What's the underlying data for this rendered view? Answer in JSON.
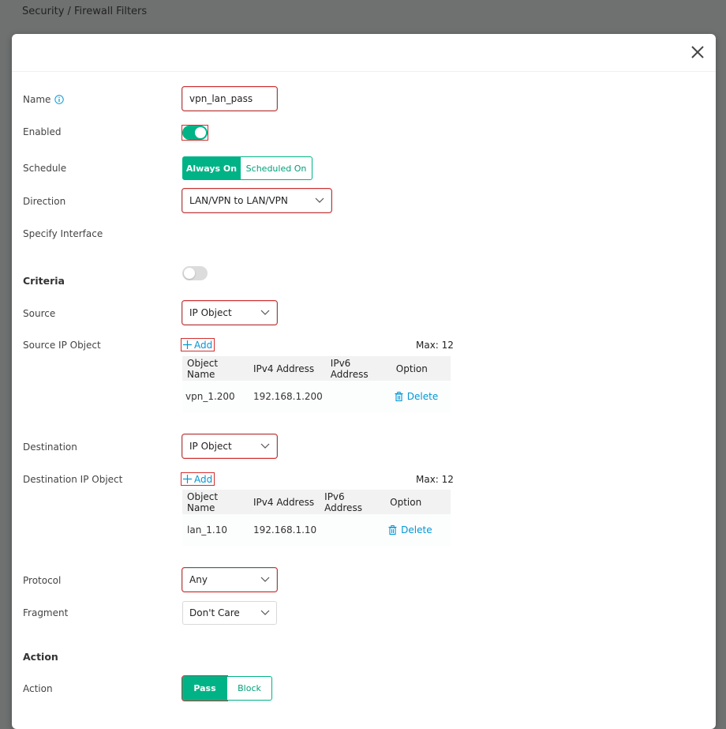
{
  "breadcrumb": "Security / Firewall Filters",
  "form": {
    "name_label": "Name",
    "name_value": "vpn_lan_pass",
    "enabled_label": "Enabled",
    "enabled": true,
    "schedule_label": "Schedule",
    "schedule_options": [
      "Always On",
      "Scheduled On"
    ],
    "schedule_selected": "Always On",
    "direction_label": "Direction",
    "direction_value": "LAN/VPN to LAN/VPN",
    "interface_label": "Specify Interface",
    "interface_enabled": false
  },
  "criteria": {
    "heading": "Criteria",
    "source_label": "Source",
    "source_value": "IP Object",
    "source_ip_label": "Source IP Object",
    "add_label": "Add",
    "max_label": "Max: 12",
    "columns": [
      "Object Name",
      "IPv4 Address",
      "IPv6 Address",
      "Option"
    ],
    "source_rows": [
      {
        "name": "vpn_1.200",
        "ipv4": "192.168.1.200",
        "ipv6": "",
        "option": "Delete"
      }
    ],
    "destination_label": "Destination",
    "destination_value": "IP Object",
    "destination_ip_label": "Destination IP Object",
    "destination_rows": [
      {
        "name": "lan_1.10",
        "ipv4": "192.168.1.10",
        "ipv6": "",
        "option": "Delete"
      }
    ],
    "protocol_label": "Protocol",
    "protocol_value": "Any",
    "fragment_label": "Fragment",
    "fragment_value": "Don't Care"
  },
  "action": {
    "heading": "Action",
    "label": "Action",
    "options": [
      "Pass",
      "Block"
    ],
    "selected": "Pass"
  },
  "colors": {
    "accent": "#00b386",
    "link": "#0097d6",
    "highlight_border": "#d32f2f",
    "overlay": "#6f7070"
  }
}
